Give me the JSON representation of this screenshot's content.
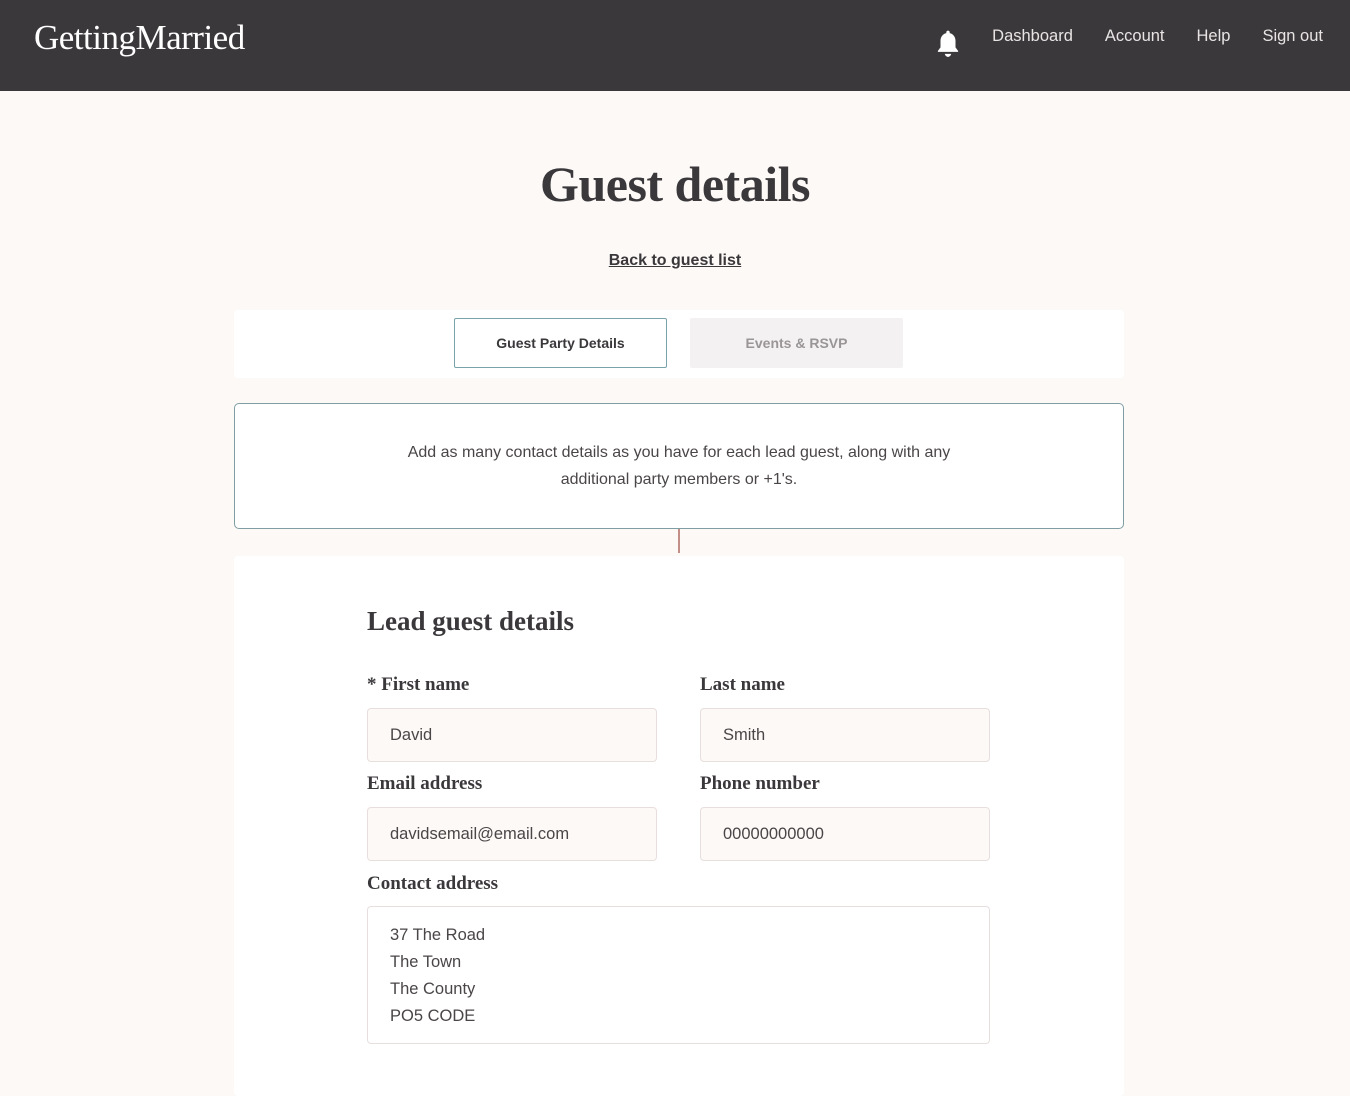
{
  "header": {
    "logo": "GettingMarried",
    "nav": [
      "Dashboard",
      "Account",
      "Help",
      "Sign out"
    ],
    "bell_icon": "bell-icon"
  },
  "page": {
    "title": "Guest details",
    "back_link": "Back to guest list"
  },
  "tabs": [
    {
      "label": "Guest Party Details",
      "active": true
    },
    {
      "label": "Events & RSVP",
      "active": false
    }
  ],
  "info": {
    "text": "Add as many contact details as you have for each lead guest, along with any additional party members or +1's."
  },
  "form": {
    "section_title": "Lead guest details",
    "first_name_label": "* First name",
    "first_name_value": "David",
    "last_name_label": "Last name",
    "last_name_value": "Smith",
    "email_label": "Email address",
    "email_value": "davidsemail@email.com",
    "phone_label": "Phone number",
    "phone_value": "00000000000",
    "address_label": "Contact address",
    "address_lines": [
      "37 The Road",
      "The Town",
      "The County",
      "PO5 CODE"
    ]
  },
  "colors": {
    "header_bg": "#3b383c",
    "page_bg": "#fcf9f7",
    "active_tab_border": "#7aa3a9",
    "connector": "#c38e86"
  }
}
